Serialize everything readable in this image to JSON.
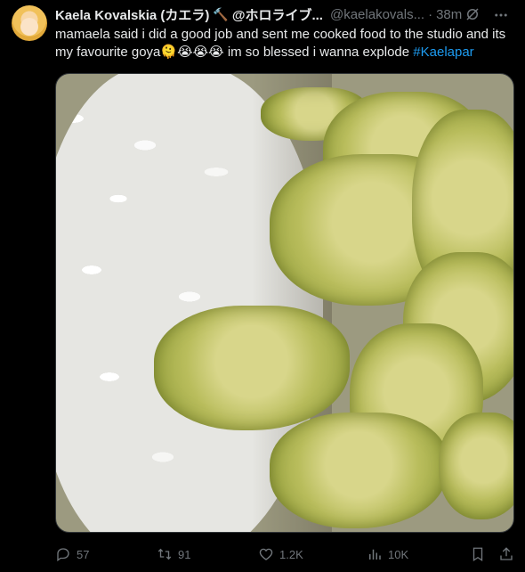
{
  "author": {
    "name": "Kaela Kovalskia (カエラ)",
    "name_icon": "hammer-icon",
    "handle_ja": "@ホロライブ...",
    "handle": "@kaelakovals...",
    "time": "38m"
  },
  "tweet": {
    "text": "mamaela said i did a good job and sent me cooked food to the studio and its my favourite goya🫠😭😭😭 im so blessed i wanna explode",
    "hashtag": "#Kaelapar"
  },
  "actions": {
    "replies": "57",
    "reposts": "91",
    "likes": "1.2K",
    "views": "10K"
  },
  "colors": {
    "background": "#000000",
    "text": "#e7e9ea",
    "muted": "#71767b",
    "link": "#1d9bf0"
  }
}
